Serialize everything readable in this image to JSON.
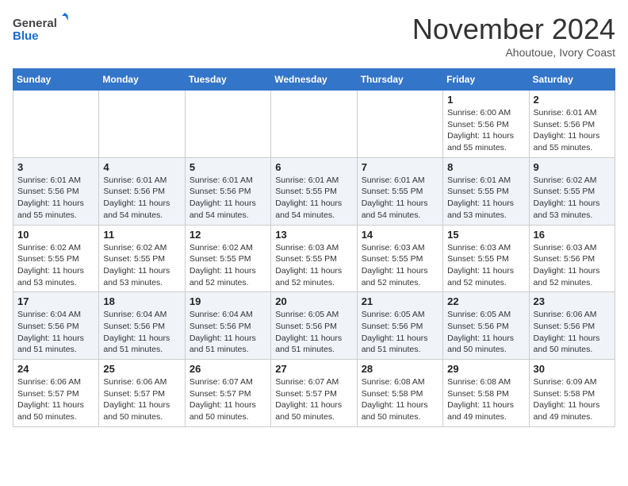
{
  "header": {
    "logo_general": "General",
    "logo_blue": "Blue",
    "month_title": "November 2024",
    "location": "Ahoutoue, Ivory Coast"
  },
  "weekdays": [
    "Sunday",
    "Monday",
    "Tuesday",
    "Wednesday",
    "Thursday",
    "Friday",
    "Saturday"
  ],
  "weeks": [
    [
      {
        "day": "",
        "info": ""
      },
      {
        "day": "",
        "info": ""
      },
      {
        "day": "",
        "info": ""
      },
      {
        "day": "",
        "info": ""
      },
      {
        "day": "",
        "info": ""
      },
      {
        "day": "1",
        "info": "Sunrise: 6:00 AM\nSunset: 5:56 PM\nDaylight: 11 hours and 55 minutes."
      },
      {
        "day": "2",
        "info": "Sunrise: 6:01 AM\nSunset: 5:56 PM\nDaylight: 11 hours and 55 minutes."
      }
    ],
    [
      {
        "day": "3",
        "info": "Sunrise: 6:01 AM\nSunset: 5:56 PM\nDaylight: 11 hours and 55 minutes."
      },
      {
        "day": "4",
        "info": "Sunrise: 6:01 AM\nSunset: 5:56 PM\nDaylight: 11 hours and 54 minutes."
      },
      {
        "day": "5",
        "info": "Sunrise: 6:01 AM\nSunset: 5:56 PM\nDaylight: 11 hours and 54 minutes."
      },
      {
        "day": "6",
        "info": "Sunrise: 6:01 AM\nSunset: 5:55 PM\nDaylight: 11 hours and 54 minutes."
      },
      {
        "day": "7",
        "info": "Sunrise: 6:01 AM\nSunset: 5:55 PM\nDaylight: 11 hours and 54 minutes."
      },
      {
        "day": "8",
        "info": "Sunrise: 6:01 AM\nSunset: 5:55 PM\nDaylight: 11 hours and 53 minutes."
      },
      {
        "day": "9",
        "info": "Sunrise: 6:02 AM\nSunset: 5:55 PM\nDaylight: 11 hours and 53 minutes."
      }
    ],
    [
      {
        "day": "10",
        "info": "Sunrise: 6:02 AM\nSunset: 5:55 PM\nDaylight: 11 hours and 53 minutes."
      },
      {
        "day": "11",
        "info": "Sunrise: 6:02 AM\nSunset: 5:55 PM\nDaylight: 11 hours and 53 minutes."
      },
      {
        "day": "12",
        "info": "Sunrise: 6:02 AM\nSunset: 5:55 PM\nDaylight: 11 hours and 52 minutes."
      },
      {
        "day": "13",
        "info": "Sunrise: 6:03 AM\nSunset: 5:55 PM\nDaylight: 11 hours and 52 minutes."
      },
      {
        "day": "14",
        "info": "Sunrise: 6:03 AM\nSunset: 5:55 PM\nDaylight: 11 hours and 52 minutes."
      },
      {
        "day": "15",
        "info": "Sunrise: 6:03 AM\nSunset: 5:55 PM\nDaylight: 11 hours and 52 minutes."
      },
      {
        "day": "16",
        "info": "Sunrise: 6:03 AM\nSunset: 5:56 PM\nDaylight: 11 hours and 52 minutes."
      }
    ],
    [
      {
        "day": "17",
        "info": "Sunrise: 6:04 AM\nSunset: 5:56 PM\nDaylight: 11 hours and 51 minutes."
      },
      {
        "day": "18",
        "info": "Sunrise: 6:04 AM\nSunset: 5:56 PM\nDaylight: 11 hours and 51 minutes."
      },
      {
        "day": "19",
        "info": "Sunrise: 6:04 AM\nSunset: 5:56 PM\nDaylight: 11 hours and 51 minutes."
      },
      {
        "day": "20",
        "info": "Sunrise: 6:05 AM\nSunset: 5:56 PM\nDaylight: 11 hours and 51 minutes."
      },
      {
        "day": "21",
        "info": "Sunrise: 6:05 AM\nSunset: 5:56 PM\nDaylight: 11 hours and 51 minutes."
      },
      {
        "day": "22",
        "info": "Sunrise: 6:05 AM\nSunset: 5:56 PM\nDaylight: 11 hours and 50 minutes."
      },
      {
        "day": "23",
        "info": "Sunrise: 6:06 AM\nSunset: 5:56 PM\nDaylight: 11 hours and 50 minutes."
      }
    ],
    [
      {
        "day": "24",
        "info": "Sunrise: 6:06 AM\nSunset: 5:57 PM\nDaylight: 11 hours and 50 minutes."
      },
      {
        "day": "25",
        "info": "Sunrise: 6:06 AM\nSunset: 5:57 PM\nDaylight: 11 hours and 50 minutes."
      },
      {
        "day": "26",
        "info": "Sunrise: 6:07 AM\nSunset: 5:57 PM\nDaylight: 11 hours and 50 minutes."
      },
      {
        "day": "27",
        "info": "Sunrise: 6:07 AM\nSunset: 5:57 PM\nDaylight: 11 hours and 50 minutes."
      },
      {
        "day": "28",
        "info": "Sunrise: 6:08 AM\nSunset: 5:58 PM\nDaylight: 11 hours and 50 minutes."
      },
      {
        "day": "29",
        "info": "Sunrise: 6:08 AM\nSunset: 5:58 PM\nDaylight: 11 hours and 49 minutes."
      },
      {
        "day": "30",
        "info": "Sunrise: 6:09 AM\nSunset: 5:58 PM\nDaylight: 11 hours and 49 minutes."
      }
    ]
  ]
}
